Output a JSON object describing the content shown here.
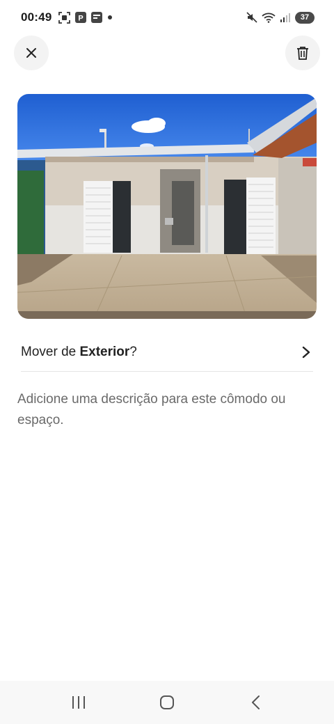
{
  "status_bar": {
    "time": "00:49",
    "battery": "37",
    "left_icons": [
      "screenshot-icon",
      "parking-icon",
      "notes-icon",
      "dot-icon"
    ],
    "right_icons": [
      "mute-icon",
      "wifi-icon",
      "signal-icon",
      "battery-icon"
    ]
  },
  "header": {
    "close_icon": "close-icon",
    "delete_icon": "trash-icon"
  },
  "photo": {
    "subject": "room-photo"
  },
  "move": {
    "prefix": "Mover de ",
    "room": "Exterior",
    "suffix": "?"
  },
  "description": {
    "placeholder": "Adicione uma descrição para este cômodo ou espaço."
  },
  "nav": {
    "icons": [
      "recent-apps-icon",
      "home-icon",
      "back-icon"
    ]
  },
  "colors": {
    "accent_text": "#222222",
    "muted_text": "#6a6a6a",
    "button_bg": "#f3f3f3"
  }
}
